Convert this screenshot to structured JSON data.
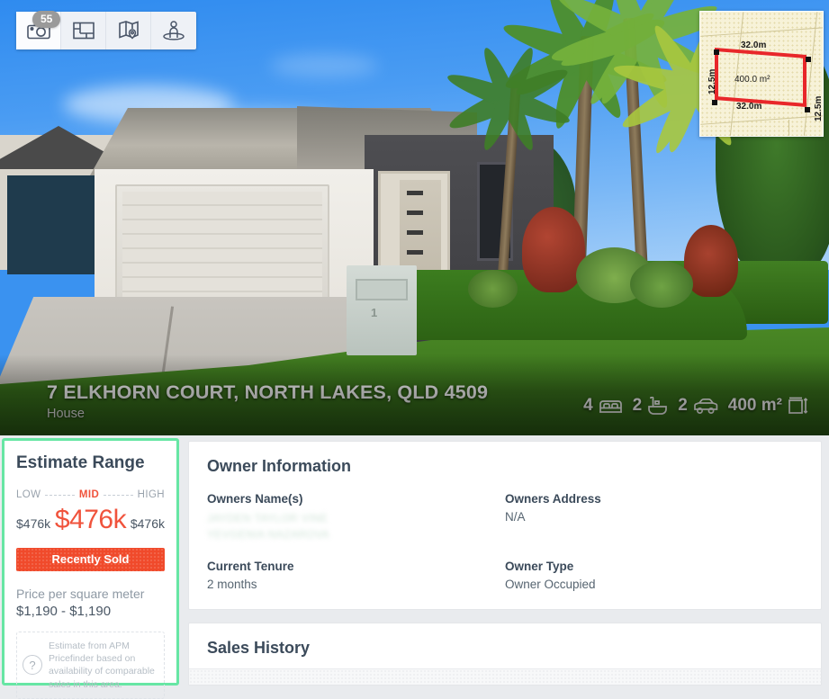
{
  "media_toolbar": {
    "photo_count_badge": "55",
    "buttons": [
      {
        "name": "camera-icon",
        "label": "Photos"
      },
      {
        "name": "floorplan-icon",
        "label": "Floorplan"
      },
      {
        "name": "map-pin-icon",
        "label": "Map"
      },
      {
        "name": "street-view-icon",
        "label": "Street View"
      }
    ]
  },
  "site_plan": {
    "top_dimension": "32.0m",
    "bottom_dimension": "32.0m",
    "left_dimension": "12.5m",
    "right_dimension": "12.5m",
    "area_label": "400.0 m²",
    "outline_color": "#e8272a",
    "background_color": "#f7f2d8"
  },
  "property": {
    "address": "7 ELKHORN COURT, NORTH LAKES, QLD 4509",
    "type": "House",
    "stats": [
      {
        "icon": "bed-icon",
        "value": "4"
      },
      {
        "icon": "bath-icon",
        "value": "2"
      },
      {
        "icon": "car-icon",
        "value": "2"
      },
      {
        "icon": "land-size-icon",
        "value": "400 m²"
      }
    ]
  },
  "estimate": {
    "title": "Estimate Range",
    "low_label": "LOW",
    "mid_label": "MID",
    "high_label": "HIGH",
    "low_value": "$476k",
    "mid_value": "$476k",
    "high_value": "$476k",
    "status_badge": "Recently Sold",
    "status_color": "#f04a2b",
    "mid_color": "#f0533c",
    "highlight_border_color": "#67e6a4",
    "ppsm_label": "Price per square meter",
    "ppsm_value": "$1,190 - $1,190",
    "help_icon": "?",
    "help_text": "Estimate from APM Pricefinder based on availability of comparable sales in this area."
  },
  "owner_information": {
    "title": "Owner Information",
    "fields": [
      {
        "label": "Owners Name(s)",
        "value": "JAYDEN TAYLOR VINE\nYEVGENIA NAZAROVA",
        "redacted": true
      },
      {
        "label": "Owners Address",
        "value": "N/A",
        "redacted": false
      },
      {
        "label": "Current Tenure",
        "value": "2 months",
        "redacted": false
      },
      {
        "label": "Owner Type",
        "value": "Owner Occupied",
        "redacted": false
      }
    ]
  },
  "sales_history": {
    "title": "Sales History"
  }
}
